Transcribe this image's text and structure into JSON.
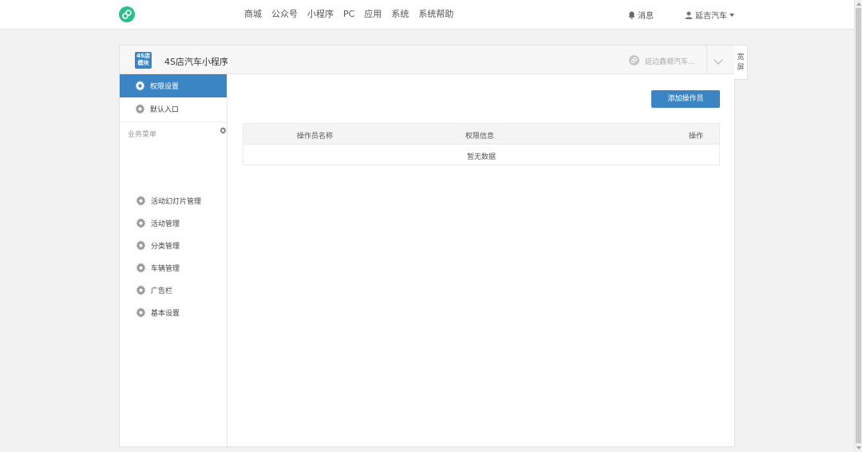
{
  "topbar": {
    "nav": [
      "商城",
      "公众号",
      "小程序",
      "PC",
      "应用",
      "系统",
      "系统帮助"
    ],
    "messages_label": "消息",
    "user_label": "延吉汽车"
  },
  "app": {
    "icon_text_line1": "4S店",
    "icon_text_line2": "模块",
    "title": "4S店汽车小程序",
    "shop_name": "延边鑫顺汽车..."
  },
  "wide_button": {
    "line1": "宽",
    "line2": "屏"
  },
  "sidebar": {
    "top_items": [
      {
        "label": "权限设置",
        "active": true
      },
      {
        "label": "默认入口",
        "active": false
      }
    ],
    "section_label": "业务菜单",
    "menu_items": [
      "活动幻灯片管理",
      "活动管理",
      "分类管理",
      "车辆管理",
      "广告栏",
      "基本设置"
    ]
  },
  "main": {
    "add_button": "添加操作员",
    "table": {
      "headers": [
        "操作员名称",
        "权限信息",
        "操作"
      ],
      "empty_text": "暂无数据"
    }
  },
  "colors": {
    "primary": "#3b85c4",
    "logo_green": "#2bc08a"
  }
}
